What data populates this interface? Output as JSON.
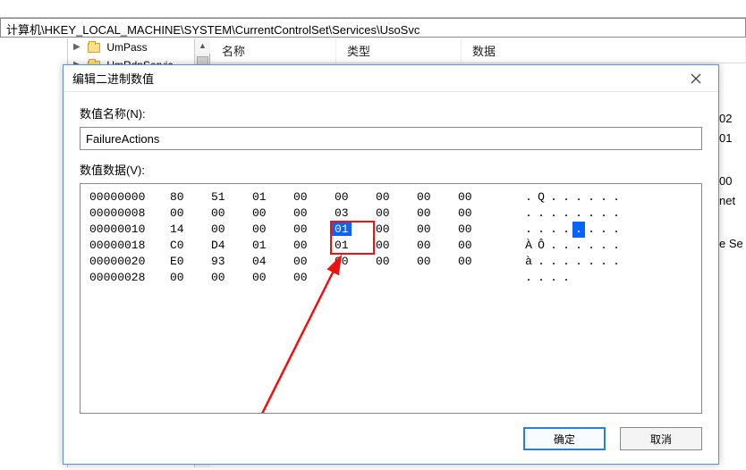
{
  "address_bar": "计算机\\HKEY_LOCAL_MACHINE\\SYSTEM\\CurrentControlSet\\Services\\UsoSvc",
  "tree": {
    "items": [
      {
        "label": "UmPass",
        "expanded": true
      },
      {
        "label": "UmRdpServic",
        "expanded": false
      }
    ]
  },
  "list_columns": {
    "name": "名称",
    "type": "类型",
    "data": "数据"
  },
  "right_edge_fragments": [
    "02",
    "01",
    "00",
    "net",
    "e Se"
  ],
  "dialog": {
    "title": "编辑二进制数值",
    "value_name_label": "数值名称(N):",
    "value_name": "FailureActions",
    "value_data_label": "数值数据(V):",
    "ok_label": "确定",
    "cancel_label": "取消"
  },
  "hex": {
    "rows": [
      {
        "offset": "00000000",
        "bytes": [
          "80",
          "51",
          "01",
          "00",
          "00",
          "00",
          "00",
          "00"
        ],
        "ascii": [
          ".",
          "Q",
          ".",
          ".",
          ".",
          ".",
          ".",
          "."
        ],
        "sel_byte": -1,
        "sel_ascii": -1
      },
      {
        "offset": "00000008",
        "bytes": [
          "00",
          "00",
          "00",
          "00",
          "03",
          "00",
          "00",
          "00"
        ],
        "ascii": [
          ".",
          ".",
          ".",
          ".",
          ".",
          ".",
          ".",
          "."
        ],
        "sel_byte": -1,
        "sel_ascii": -1
      },
      {
        "offset": "00000010",
        "bytes": [
          "14",
          "00",
          "00",
          "00",
          "01",
          "00",
          "00",
          "00"
        ],
        "ascii": [
          ".",
          ".",
          ".",
          ".",
          ".",
          ".",
          ".",
          "."
        ],
        "sel_byte": 4,
        "sel_ascii": 4
      },
      {
        "offset": "00000018",
        "bytes": [
          "C0",
          "D4",
          "01",
          "00",
          "01",
          "00",
          "00",
          "00"
        ],
        "ascii": [
          "À",
          "Ô",
          ".",
          ".",
          ".",
          ".",
          ".",
          "."
        ],
        "sel_byte": -1,
        "sel_ascii": -1
      },
      {
        "offset": "00000020",
        "bytes": [
          "E0",
          "93",
          "04",
          "00",
          "00",
          "00",
          "00",
          "00"
        ],
        "ascii": [
          "à",
          ".",
          ".",
          ".",
          ".",
          ".",
          ".",
          "."
        ],
        "sel_byte": -1,
        "sel_ascii": -1
      },
      {
        "offset": "00000028",
        "bytes": [
          "00",
          "00",
          "00",
          "00"
        ],
        "ascii": [
          ".",
          ".",
          ".",
          "."
        ],
        "sel_byte": -1,
        "sel_ascii": -1
      }
    ],
    "red_box_rows": [
      2,
      3
    ],
    "red_box_col": 4
  }
}
